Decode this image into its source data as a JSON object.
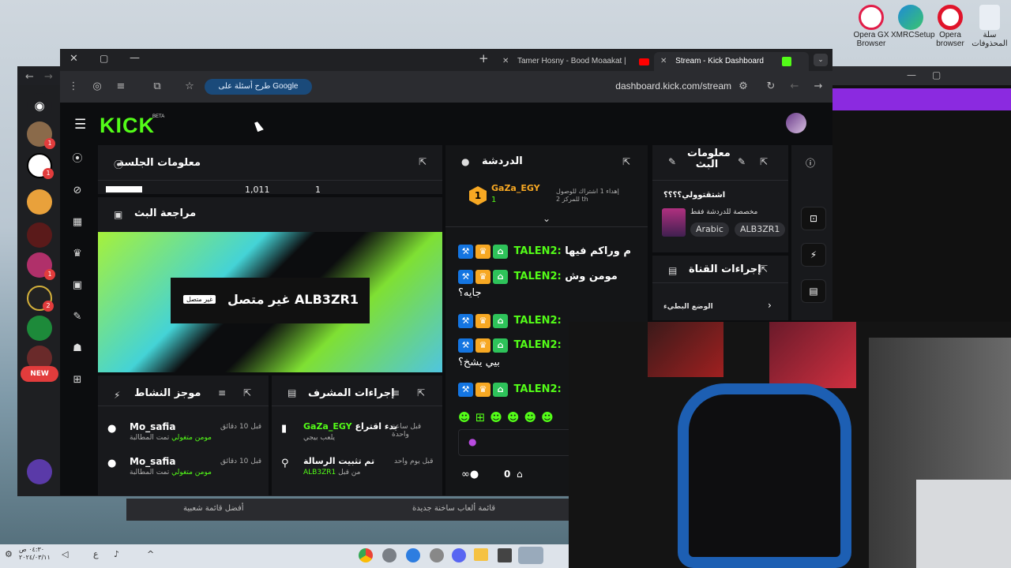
{
  "desktop": {
    "icons": [
      {
        "label": "Opera GX Browser",
        "icon": "opera-gx-icon",
        "color": "#e11d48"
      },
      {
        "label": "XMRCSetup",
        "icon": "edge-icon",
        "color": "#1f8bd6"
      },
      {
        "label": "Opera browser",
        "icon": "opera-icon",
        "color": "#e0142a"
      },
      {
        "label": "سلة المحذوفات",
        "icon": "recycle-bin-icon",
        "color": "#cfd8e3"
      }
    ]
  },
  "browser": {
    "tabs": [
      {
        "label": "Tamer Hosny - Bood Moaakat |",
        "icon": "youtube-icon"
      },
      {
        "label": "Stream - Kick Dashboard",
        "icon": "kick-icon"
      }
    ],
    "new_tab": "+",
    "google_pill": "طرح أسئلة على Google",
    "url": "dashboard.kick.com/stream"
  },
  "kick": {
    "logo": "KICK",
    "beta": "BETA",
    "accent": "#53fc18",
    "session": {
      "title": "معلومات الجلسة",
      "stats": [
        "",
        "1,011",
        "1"
      ]
    },
    "review": {
      "title": "مراجعة البث",
      "channel": "ALB3ZR1",
      "status": "غير متصل",
      "badge": "غير متصل"
    },
    "activity": {
      "title": "موجز النشاط",
      "items": [
        {
          "user": "Mo_safia",
          "time": "قبل 10 دقائق",
          "prefix": "تمت المطالبة",
          "reward": "مومن متغولي"
        },
        {
          "user": "Mo_safia",
          "time": "قبل 10 دقائق",
          "prefix": "تمت المطالبة",
          "reward": "مومن متغولي"
        }
      ]
    },
    "mod": {
      "title": "إجراءات المشرف",
      "items": [
        {
          "user": "GaZa_EGY",
          "action": "بدء اقتراع",
          "sub": "يلعب بيجي",
          "time": "قبل ساعة واحدة"
        },
        {
          "user": "",
          "action": "تم تثبيت الرسالة",
          "sub": "من قبل",
          "by": "ALB3ZR1",
          "time": "قبل يوم واحد"
        }
      ]
    },
    "chat": {
      "title": "الدردشة",
      "pinned_user": "GaZa_EGY",
      "pinned_text": "إهداء 1 اشتراك للوصول للمركز 2 th",
      "rank": "1",
      "gift_count": "1",
      "messages": [
        {
          "user": "TALEN2:",
          "text": "م وراكم فيها"
        },
        {
          "user": "TALEN2:",
          "text": "مومن وش",
          "text2": "جايه؟"
        },
        {
          "user": "TALEN2:",
          "text": ""
        },
        {
          "user": "TALEN2:",
          "text": "",
          "text2": "بيي يشخ؟"
        },
        {
          "user": "TALEN2:",
          "text": ""
        }
      ],
      "viewers": "0"
    },
    "info": {
      "title": "معلومات البث",
      "stream_title": "اشتقتوولي؟؟؟؟",
      "category": "مخصصة للدردشة فقط",
      "tags": [
        "Arabic",
        "ALB3ZR1"
      ]
    },
    "channel_actions": {
      "title": "إجراءات القناة",
      "item": "الوضع البطيء"
    }
  },
  "bottom": {
    "items": [
      "أفضل قائمة شعبية",
      "قائمة ألعاب ساخنة جديدة"
    ]
  },
  "taskbar": {
    "time": "٠٤:٣٠ ص",
    "date": "٢٠٢٤/٠٣/١١",
    "lang": "ع"
  }
}
